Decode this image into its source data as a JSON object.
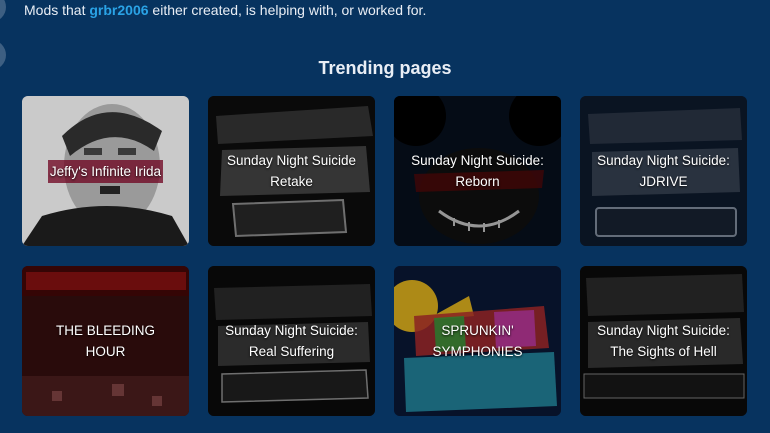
{
  "intro": {
    "prefix": "Mods that ",
    "username": "grbr2006",
    "suffix": " either created, is helping with, or worked for."
  },
  "trending": {
    "title": "Trending pages",
    "cards": [
      {
        "title": "Jeffy's Infinite Irida",
        "art_text": ""
      },
      {
        "title": "Sunday Night Suicide Retake",
        "art_text": "SUNDAY NIGHT SUICIDE RETAKE"
      },
      {
        "title": "Sunday Night Suicide: Reborn",
        "art_text": "REBORN"
      },
      {
        "title": "Sunday Night Suicide: JDRIVE",
        "art_text": "SUNDAY NIGHT SUICIDE JDRIVE"
      },
      {
        "title": "THE BLEEDING HOUR",
        "art_text": "bleeding hou"
      },
      {
        "title": "Sunday Night Suicide: Real Suffering",
        "art_text": "SUNDAY NIGHT SUICIDE \"REAL SUFFERING\""
      },
      {
        "title": "SPRUNKIN' SYMPHONIES",
        "art_text": "SPRUNKIN' SYMPHONIES"
      },
      {
        "title": "Sunday Night Suicide: The Sights of Hell",
        "art_text": "SUNDAY NIGHT SUICIDE THE SIGHTS OF HELL"
      }
    ]
  },
  "colors": {
    "background": "#07335f",
    "accent": "#2aa3e6",
    "card_background": "#0a1f36"
  }
}
